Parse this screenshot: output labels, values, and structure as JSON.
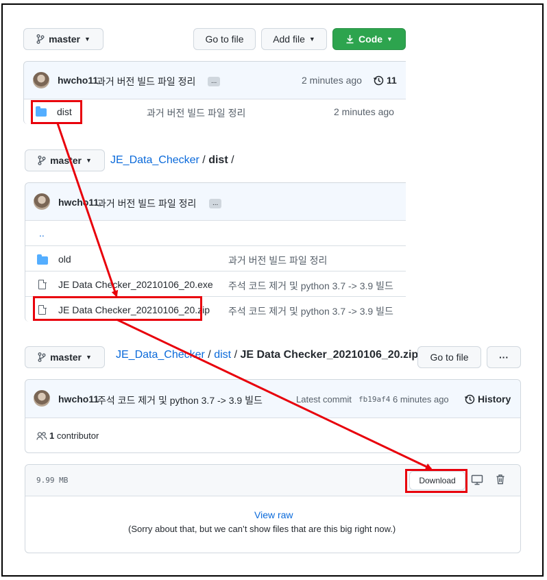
{
  "panel1": {
    "branch_label": "master",
    "go_to_file": "Go to file",
    "add_file": "Add file",
    "code": "Code",
    "commit_user": "hwcho11",
    "commit_msg": "과거 버전 빌드 파일 정리",
    "ellipsis": "...",
    "commit_time": "2 minutes ago",
    "commit_count": "11",
    "folder_name": "dist",
    "folder_msg": "과거 버전 빌드 파일 정리",
    "folder_time": "2 minutes ago"
  },
  "panel2": {
    "branch_label": "master",
    "breadcrumb_repo": "JE_Data_Checker",
    "breadcrumb_sep": "/",
    "breadcrumb_dir": "dist",
    "breadcrumb_sep2": "/",
    "commit_user": "hwcho11",
    "commit_msg": "과거 버전 빌드 파일 정리",
    "ellipsis": "...",
    "parent_dir": "..",
    "rows": [
      {
        "name": "old",
        "msg": "과거 버전 빌드 파일 정리"
      },
      {
        "name": "JE Data Checker_20210106_20.exe",
        "msg": "주석 코드 제거 및 python 3.7 -> 3.9 빌드"
      },
      {
        "name": "JE Data Checker_20210106_20.zip",
        "msg": "주석 코드 제거 및 python 3.7 -> 3.9 빌드"
      }
    ]
  },
  "panel3": {
    "branch_label": "master",
    "breadcrumb_repo": "JE_Data_Checker",
    "breadcrumb_sep": "/",
    "breadcrumb_dir": "dist",
    "breadcrumb_sep2": "/",
    "breadcrumb_file": "JE Data Checker_20210106_20.zip",
    "go_to_file": "Go to file",
    "more": "···",
    "commit_user": "hwcho11",
    "commit_msg": "주석 코드 제거 및 python 3.7 -> 3.9 빌드",
    "latest_commit_label": "Latest commit",
    "commit_sha": "fb19af4",
    "commit_time": "6 minutes ago",
    "history": "History",
    "contributors_count": "1",
    "contributors_label": "contributor",
    "file_size": "9.99 MB",
    "download": "Download",
    "view_raw": "View raw",
    "too_big_msg": "(Sorry about that, but we can’t show files that are this big right now.)"
  },
  "icons": [
    "git-branch-icon",
    "chevron-down-icon",
    "download-icon",
    "history-icon",
    "folder-icon",
    "file-icon",
    "people-icon",
    "desktop-icon",
    "trash-icon"
  ],
  "colors": {
    "accent_link": "#0969da",
    "code_button": "#2da44e",
    "highlight": "#e8000b",
    "header_bg": "#f3f8fe"
  }
}
